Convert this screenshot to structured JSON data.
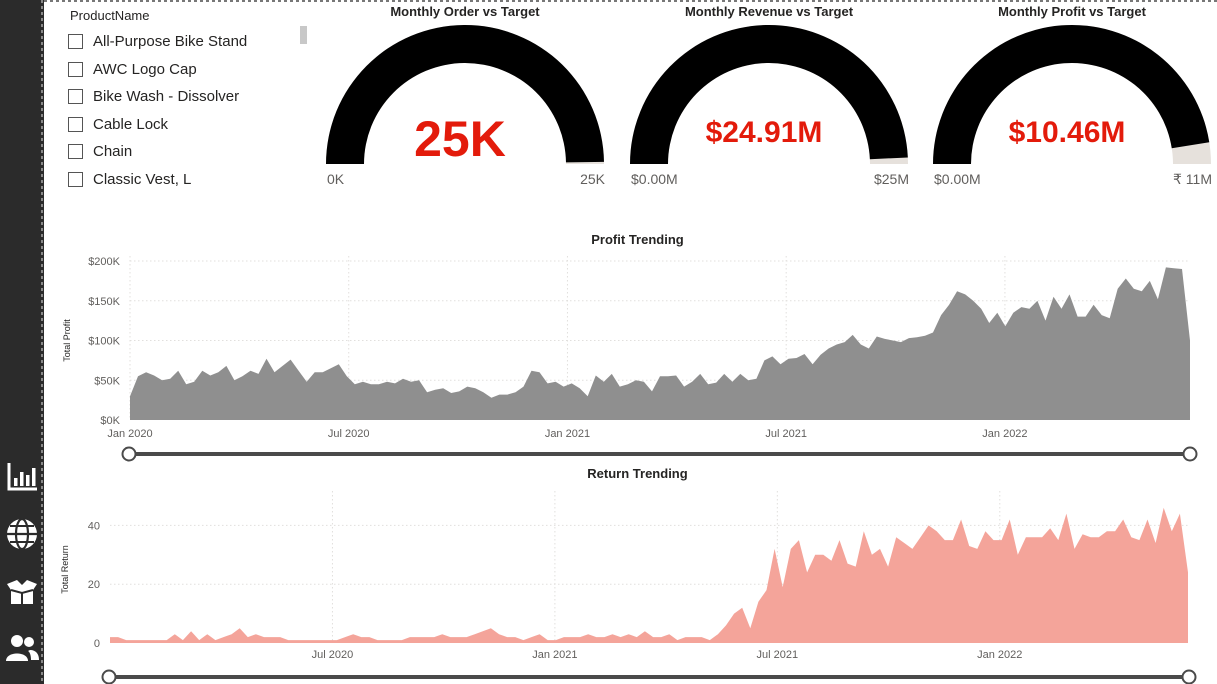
{
  "nav": {
    "icons": [
      "bar-chart-icon",
      "globe-icon",
      "box-icon",
      "users-icon"
    ]
  },
  "slicer": {
    "title": "ProductName",
    "items": [
      "All-Purpose Bike Stand",
      "AWC Logo Cap",
      "Bike Wash - Dissolver",
      "Cable Lock",
      "Chain",
      "Classic Vest, L"
    ]
  },
  "gauges": [
    {
      "title": "Monthly Order vs Target",
      "value": "25K",
      "min": "0K",
      "max": "25K",
      "fill_fraction": 0.995
    },
    {
      "title": "Monthly Revenue vs Target",
      "value": "$24.91M",
      "min": "$0.00M",
      "max": "$25M",
      "fill_fraction": 0.985
    },
    {
      "title": "Monthly Profit vs Target",
      "value": "$10.46M",
      "min": "$0.00M",
      "max": "₹ 11M",
      "fill_fraction": 0.95
    }
  ],
  "colors": {
    "gauge_fill": "#000000",
    "gauge_track": "#e6e1dc",
    "kpi_value": "#e31b0b",
    "profit_area": "#8f8f8f",
    "return_area": "#f4a49a",
    "rail_bg": "#2b2b2b"
  },
  "chart_data": [
    {
      "type": "area",
      "title": "Profit Trending",
      "xlabel": "",
      "ylabel": "Total Profit",
      "x_ticks": [
        "Jan 2020",
        "Jul 2020",
        "Jan 2021",
        "Jul 2021",
        "Jan 2022"
      ],
      "y_ticks": [
        "$0K",
        "$50K",
        "$100K",
        "$150K",
        "$200K"
      ],
      "ylim": [
        0,
        200000
      ],
      "x_range_weeks": [
        0,
        126
      ],
      "x_tick_weeks": [
        0,
        26,
        52,
        78,
        104
      ],
      "grid": true,
      "values": [
        30000,
        55000,
        60000,
        56000,
        50000,
        52000,
        62000,
        45000,
        48000,
        62000,
        56000,
        60000,
        68000,
        50000,
        55000,
        62000,
        58000,
        77000,
        60000,
        68000,
        76000,
        62000,
        48000,
        60000,
        60000,
        65000,
        70000,
        55000,
        45000,
        48000,
        45000,
        45000,
        48000,
        46000,
        52000,
        48000,
        50000,
        35000,
        38000,
        40000,
        34000,
        36000,
        42000,
        40000,
        35000,
        28000,
        32000,
        32000,
        35000,
        42000,
        62000,
        60000,
        46000,
        48000,
        42000,
        46000,
        40000,
        30000,
        56000,
        48000,
        58000,
        42000,
        45000,
        50000,
        48000,
        36000,
        55000,
        55000,
        56000,
        42000,
        48000,
        58000,
        45000,
        47000,
        58000,
        48000,
        58000,
        50000,
        52000,
        75000,
        80000,
        70000,
        77000,
        78000,
        83000,
        70000,
        82000,
        90000,
        95000,
        98000,
        107000,
        95000,
        90000,
        105000,
        102000,
        100000,
        98000,
        103000,
        104000,
        106000,
        110000,
        132000,
        145000,
        162000,
        158000,
        150000,
        140000,
        122000,
        135000,
        118000,
        135000,
        142000,
        140000,
        150000,
        125000,
        155000,
        140000,
        158000,
        130000,
        130000,
        145000,
        132000,
        128000,
        165000,
        178000,
        165000,
        162000,
        175000,
        152000,
        192000,
        191000,
        190000,
        100000
      ],
      "series": [
        {
          "name": "Total Profit"
        }
      ]
    },
    {
      "type": "area",
      "title": "Return Trending",
      "xlabel": "",
      "ylabel": "Total Return",
      "x_ticks": [
        "Jul 2020",
        "Jan 2021",
        "Jul 2021",
        "Jan 2022"
      ],
      "y_ticks": [
        "0",
        "20",
        "40"
      ],
      "ylim": [
        0,
        50
      ],
      "x_range_weeks": [
        0,
        126
      ],
      "x_tick_weeks": [
        26,
        52,
        78,
        104
      ],
      "grid": true,
      "values": [
        2,
        2,
        1,
        1,
        1,
        1,
        1,
        1,
        3,
        1,
        4,
        1,
        3,
        1,
        2,
        3,
        5,
        2,
        3,
        2,
        2,
        2,
        1,
        1,
        1,
        1,
        1,
        1,
        1,
        2,
        3,
        2,
        2,
        1,
        1,
        1,
        1,
        2,
        2,
        2,
        2,
        3,
        2,
        2,
        2,
        3,
        4,
        5,
        3,
        2,
        2,
        1,
        2,
        3,
        1,
        1,
        2,
        2,
        2,
        3,
        2,
        2,
        3,
        2,
        3,
        2,
        4,
        2,
        2,
        3,
        1,
        2,
        2,
        2,
        1,
        3,
        6,
        10,
        12,
        5,
        14,
        18,
        32,
        19,
        32,
        35,
        24,
        30,
        30,
        28,
        35,
        27,
        26,
        38,
        30,
        32,
        26,
        36,
        34,
        32,
        36,
        40,
        38,
        35,
        35,
        42,
        33,
        32,
        38,
        35,
        35,
        42,
        30,
        36,
        36,
        36,
        39,
        35,
        44,
        32,
        37,
        36,
        36,
        38,
        38,
        42,
        36,
        35,
        42,
        34,
        46,
        38,
        44,
        24
      ],
      "series": [
        {
          "name": "Total Return"
        }
      ]
    }
  ]
}
